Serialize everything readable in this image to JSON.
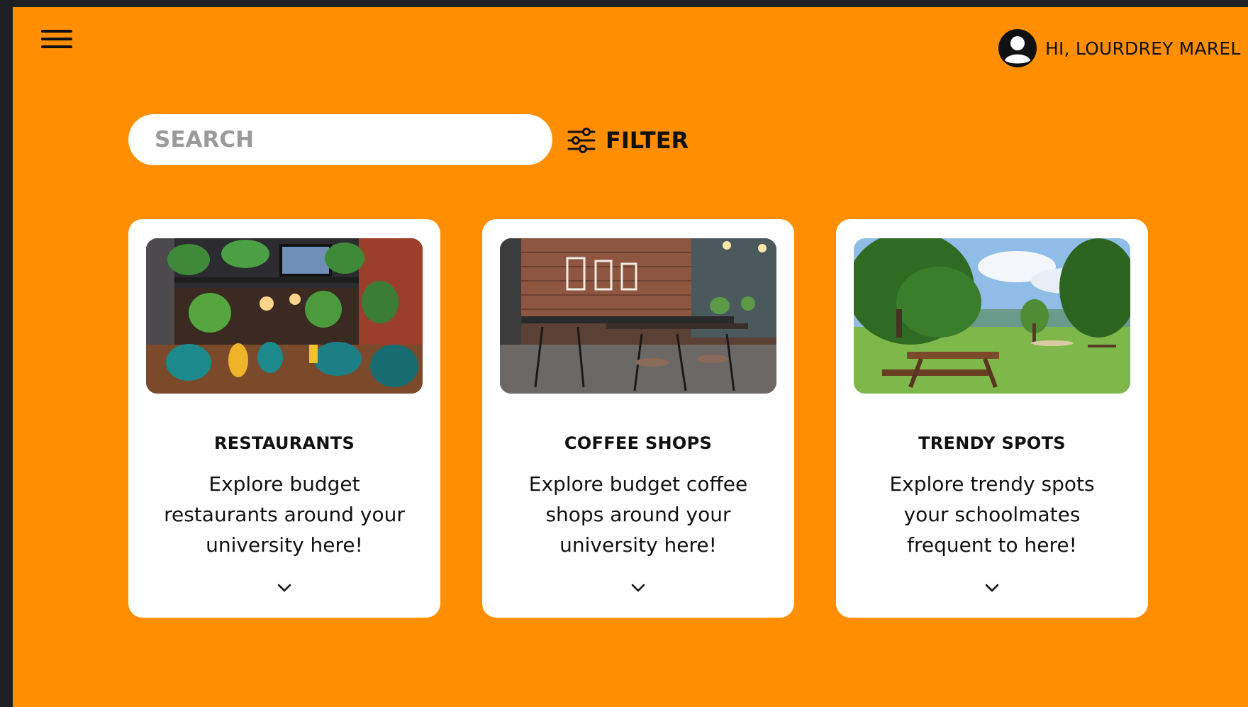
{
  "header": {
    "menu_icon": "hamburger-menu-icon",
    "user_icon": "user-avatar-icon",
    "greeting": "HI, LOURDREY MAREL"
  },
  "search": {
    "placeholder": "SEARCH",
    "value": ""
  },
  "filter": {
    "icon": "sliders-icon",
    "label": "FILTER"
  },
  "cards": [
    {
      "title": "RESTAURANTS",
      "description": "Explore budget restaurants around your university here!",
      "expand_icon": "chevron-down-icon"
    },
    {
      "title": "COFFEE SHOPS",
      "description": "Explore budget coffee shops around your university here!",
      "expand_icon": "chevron-down-icon"
    },
    {
      "title": "TRENDY SPOTS",
      "description": "Explore trendy spots your schoolmates frequent to here!",
      "expand_icon": "chevron-down-icon"
    }
  ],
  "colors": {
    "background": "#ff8f00",
    "card": "#ffffff",
    "text": "#111111",
    "outer_frame": "#1f2023"
  }
}
